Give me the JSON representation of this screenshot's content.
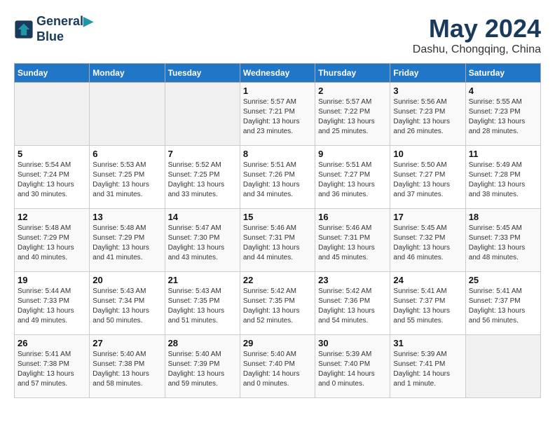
{
  "header": {
    "logo_line1": "General",
    "logo_line2": "Blue",
    "title": "May 2024",
    "location": "Dashu, Chongqing, China"
  },
  "weekdays": [
    "Sunday",
    "Monday",
    "Tuesday",
    "Wednesday",
    "Thursday",
    "Friday",
    "Saturday"
  ],
  "weeks": [
    [
      {
        "day": "",
        "info": ""
      },
      {
        "day": "",
        "info": ""
      },
      {
        "day": "",
        "info": ""
      },
      {
        "day": "1",
        "info": "Sunrise: 5:57 AM\nSunset: 7:21 PM\nDaylight: 13 hours\nand 23 minutes."
      },
      {
        "day": "2",
        "info": "Sunrise: 5:57 AM\nSunset: 7:22 PM\nDaylight: 13 hours\nand 25 minutes."
      },
      {
        "day": "3",
        "info": "Sunrise: 5:56 AM\nSunset: 7:23 PM\nDaylight: 13 hours\nand 26 minutes."
      },
      {
        "day": "4",
        "info": "Sunrise: 5:55 AM\nSunset: 7:23 PM\nDaylight: 13 hours\nand 28 minutes."
      }
    ],
    [
      {
        "day": "5",
        "info": "Sunrise: 5:54 AM\nSunset: 7:24 PM\nDaylight: 13 hours\nand 30 minutes."
      },
      {
        "day": "6",
        "info": "Sunrise: 5:53 AM\nSunset: 7:25 PM\nDaylight: 13 hours\nand 31 minutes."
      },
      {
        "day": "7",
        "info": "Sunrise: 5:52 AM\nSunset: 7:25 PM\nDaylight: 13 hours\nand 33 minutes."
      },
      {
        "day": "8",
        "info": "Sunrise: 5:51 AM\nSunset: 7:26 PM\nDaylight: 13 hours\nand 34 minutes."
      },
      {
        "day": "9",
        "info": "Sunrise: 5:51 AM\nSunset: 7:27 PM\nDaylight: 13 hours\nand 36 minutes."
      },
      {
        "day": "10",
        "info": "Sunrise: 5:50 AM\nSunset: 7:27 PM\nDaylight: 13 hours\nand 37 minutes."
      },
      {
        "day": "11",
        "info": "Sunrise: 5:49 AM\nSunset: 7:28 PM\nDaylight: 13 hours\nand 38 minutes."
      }
    ],
    [
      {
        "day": "12",
        "info": "Sunrise: 5:48 AM\nSunset: 7:29 PM\nDaylight: 13 hours\nand 40 minutes."
      },
      {
        "day": "13",
        "info": "Sunrise: 5:48 AM\nSunset: 7:29 PM\nDaylight: 13 hours\nand 41 minutes."
      },
      {
        "day": "14",
        "info": "Sunrise: 5:47 AM\nSunset: 7:30 PM\nDaylight: 13 hours\nand 43 minutes."
      },
      {
        "day": "15",
        "info": "Sunrise: 5:46 AM\nSunset: 7:31 PM\nDaylight: 13 hours\nand 44 minutes."
      },
      {
        "day": "16",
        "info": "Sunrise: 5:46 AM\nSunset: 7:31 PM\nDaylight: 13 hours\nand 45 minutes."
      },
      {
        "day": "17",
        "info": "Sunrise: 5:45 AM\nSunset: 7:32 PM\nDaylight: 13 hours\nand 46 minutes."
      },
      {
        "day": "18",
        "info": "Sunrise: 5:45 AM\nSunset: 7:33 PM\nDaylight: 13 hours\nand 48 minutes."
      }
    ],
    [
      {
        "day": "19",
        "info": "Sunrise: 5:44 AM\nSunset: 7:33 PM\nDaylight: 13 hours\nand 49 minutes."
      },
      {
        "day": "20",
        "info": "Sunrise: 5:43 AM\nSunset: 7:34 PM\nDaylight: 13 hours\nand 50 minutes."
      },
      {
        "day": "21",
        "info": "Sunrise: 5:43 AM\nSunset: 7:35 PM\nDaylight: 13 hours\nand 51 minutes."
      },
      {
        "day": "22",
        "info": "Sunrise: 5:42 AM\nSunset: 7:35 PM\nDaylight: 13 hours\nand 52 minutes."
      },
      {
        "day": "23",
        "info": "Sunrise: 5:42 AM\nSunset: 7:36 PM\nDaylight: 13 hours\nand 54 minutes."
      },
      {
        "day": "24",
        "info": "Sunrise: 5:41 AM\nSunset: 7:37 PM\nDaylight: 13 hours\nand 55 minutes."
      },
      {
        "day": "25",
        "info": "Sunrise: 5:41 AM\nSunset: 7:37 PM\nDaylight: 13 hours\nand 56 minutes."
      }
    ],
    [
      {
        "day": "26",
        "info": "Sunrise: 5:41 AM\nSunset: 7:38 PM\nDaylight: 13 hours\nand 57 minutes."
      },
      {
        "day": "27",
        "info": "Sunrise: 5:40 AM\nSunset: 7:38 PM\nDaylight: 13 hours\nand 58 minutes."
      },
      {
        "day": "28",
        "info": "Sunrise: 5:40 AM\nSunset: 7:39 PM\nDaylight: 13 hours\nand 59 minutes."
      },
      {
        "day": "29",
        "info": "Sunrise: 5:40 AM\nSunset: 7:40 PM\nDaylight: 14 hours\nand 0 minutes."
      },
      {
        "day": "30",
        "info": "Sunrise: 5:39 AM\nSunset: 7:40 PM\nDaylight: 14 hours\nand 0 minutes."
      },
      {
        "day": "31",
        "info": "Sunrise: 5:39 AM\nSunset: 7:41 PM\nDaylight: 14 hours\nand 1 minute."
      },
      {
        "day": "",
        "info": ""
      }
    ]
  ]
}
